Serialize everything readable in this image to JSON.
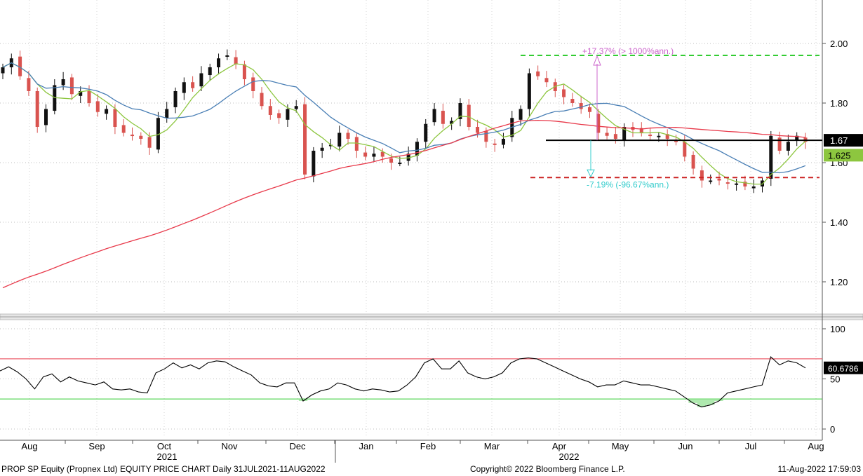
{
  "chart_data": [
    {
      "type": "candlestick",
      "title": "PROP SP Equity (Propnex Ltd) EQUITY PRICE CHART",
      "ylim": [
        1.1,
        2.15
      ],
      "y_ticks": [
        1.2,
        1.4,
        1.6,
        1.8,
        2.0
      ],
      "y_tick_labels": [
        "1.20",
        "1.40",
        "1.60",
        "1.80",
        "2.00"
      ],
      "last_price_label": "1.67",
      "ma_label": "1.625",
      "grid": true,
      "colors": {
        "up": "#111111",
        "down": "#d9534f",
        "ma_fast": "#8dc63f",
        "ma_mid": "#4a7fb5",
        "ma_slow": "#e8394a",
        "annotation_up": "#cc66cc",
        "annotation_down": "#33cccc",
        "target_up": "#33cc33",
        "target_down": "#cc2222"
      },
      "x_months": [
        "Aug",
        "Sep",
        "Oct",
        "Nov",
        "Dec",
        "Jan",
        "Feb",
        "Mar",
        "Apr",
        "May",
        "Jun",
        "Jul",
        "Aug"
      ],
      "x_years": [
        "2021",
        "2022"
      ],
      "close_series": [
        1.92,
        1.95,
        1.89,
        1.84,
        1.72,
        1.78,
        1.86,
        1.88,
        1.83,
        1.84,
        1.8,
        1.77,
        1.78,
        1.72,
        1.7,
        1.69,
        1.68,
        1.65,
        1.75,
        1.78,
        1.84,
        1.87,
        1.85,
        1.9,
        1.92,
        1.95,
        1.96,
        1.93,
        1.88,
        1.84,
        1.79,
        1.76,
        1.75,
        1.78,
        1.79,
        1.56,
        1.64,
        1.65,
        1.66,
        1.7,
        1.68,
        1.64,
        1.62,
        1.63,
        1.62,
        1.6,
        1.6,
        1.63,
        1.67,
        1.73,
        1.78,
        1.73,
        1.74,
        1.8,
        1.72,
        1.7,
        1.67,
        1.66,
        1.68,
        1.75,
        1.78,
        1.9,
        1.89,
        1.87,
        1.84,
        1.82,
        1.8,
        1.78,
        1.77,
        1.7,
        1.69,
        1.68,
        1.72,
        1.71,
        1.7,
        1.69,
        1.69,
        1.68,
        1.67,
        1.62,
        1.58,
        1.54,
        1.54,
        1.54,
        1.53,
        1.53,
        1.52,
        1.52,
        1.54,
        1.69,
        1.64,
        1.67,
        1.69,
        1.67
      ],
      "annotations": [
        {
          "text": "+17.37% (> 1000%ann.)",
          "level": 1.96,
          "color": "#cc66cc"
        },
        {
          "text": "-7.19% (-96.67%ann.)",
          "level": 1.55,
          "color": "#33cccc"
        },
        {
          "text": "",
          "level": 1.675,
          "color": "#000000"
        }
      ]
    },
    {
      "type": "line",
      "title": "",
      "ylim": [
        -5,
        105
      ],
      "y_ticks": [
        0,
        50,
        100
      ],
      "y_tick_labels": [
        "0",
        "50",
        "100"
      ],
      "overbought": 70,
      "oversold": 30,
      "last_value_label": "60.6786",
      "values": [
        58,
        62,
        57,
        50,
        40,
        52,
        55,
        47,
        52,
        48,
        46,
        44,
        47,
        40,
        39,
        40,
        37,
        36,
        56,
        60,
        66,
        61,
        64,
        60,
        66,
        68,
        67,
        62,
        58,
        54,
        46,
        43,
        42,
        46,
        46,
        28,
        34,
        38,
        40,
        46,
        44,
        40,
        38,
        40,
        39,
        37,
        38,
        44,
        52,
        66,
        70,
        60,
        60,
        68,
        56,
        52,
        50,
        52,
        56,
        66,
        70,
        71,
        70,
        66,
        62,
        58,
        54,
        50,
        47,
        42,
        44,
        44,
        48,
        46,
        44,
        44,
        42,
        40,
        38,
        32,
        26,
        22,
        24,
        28,
        36,
        38,
        40,
        42,
        44,
        72,
        64,
        68,
        66,
        61
      ]
    }
  ],
  "footer": {
    "left": "PROP SP Equity (Propnex Ltd) EQUITY PRICE CHART  Daily 31JUL2021-11AUG2022",
    "center": "Copyright© 2022 Bloomberg Finance L.P.",
    "right": "11-Aug-2022 17:59:03"
  }
}
